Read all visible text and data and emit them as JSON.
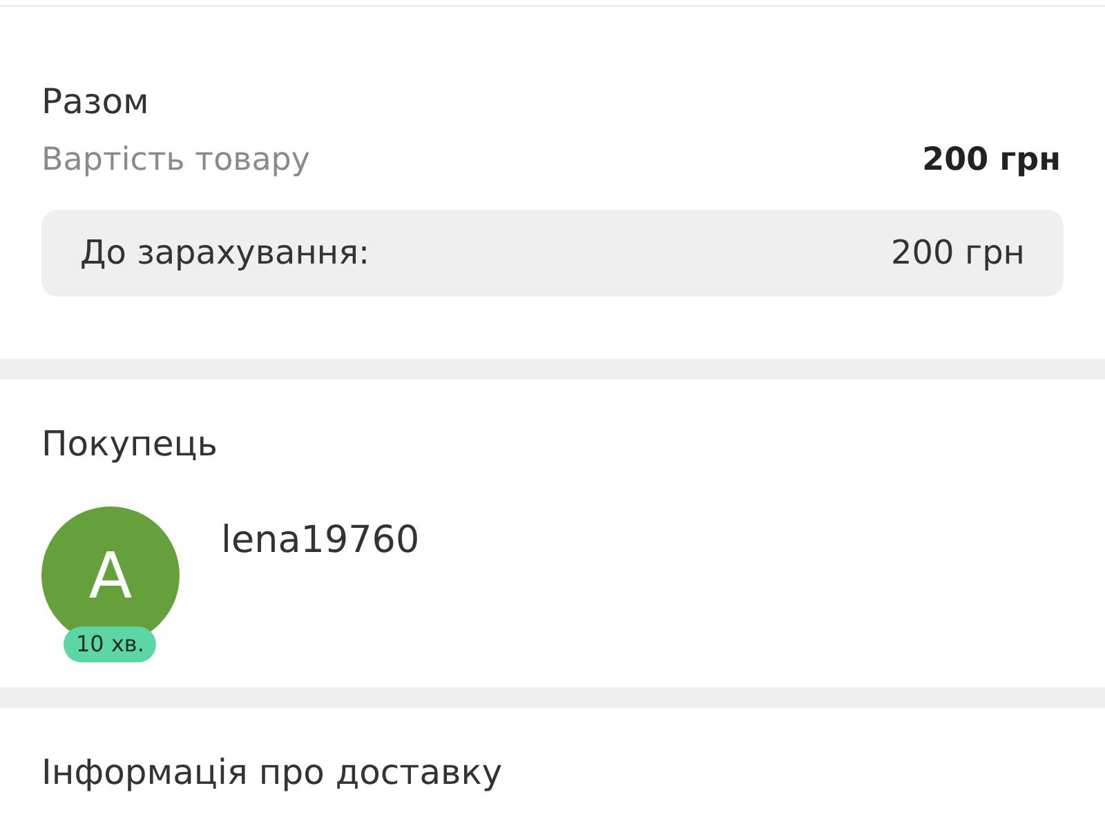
{
  "total": {
    "title": "Разом",
    "item_label": "Вартість товару",
    "item_value": "200 грн",
    "payout_label": "До зарахування:",
    "payout_value": "200 грн"
  },
  "buyer": {
    "title": "Покупець",
    "avatar_letter": "A",
    "last_seen": "10 хв.",
    "username": "lena19760"
  },
  "delivery": {
    "title": "Інформація про доставку"
  }
}
